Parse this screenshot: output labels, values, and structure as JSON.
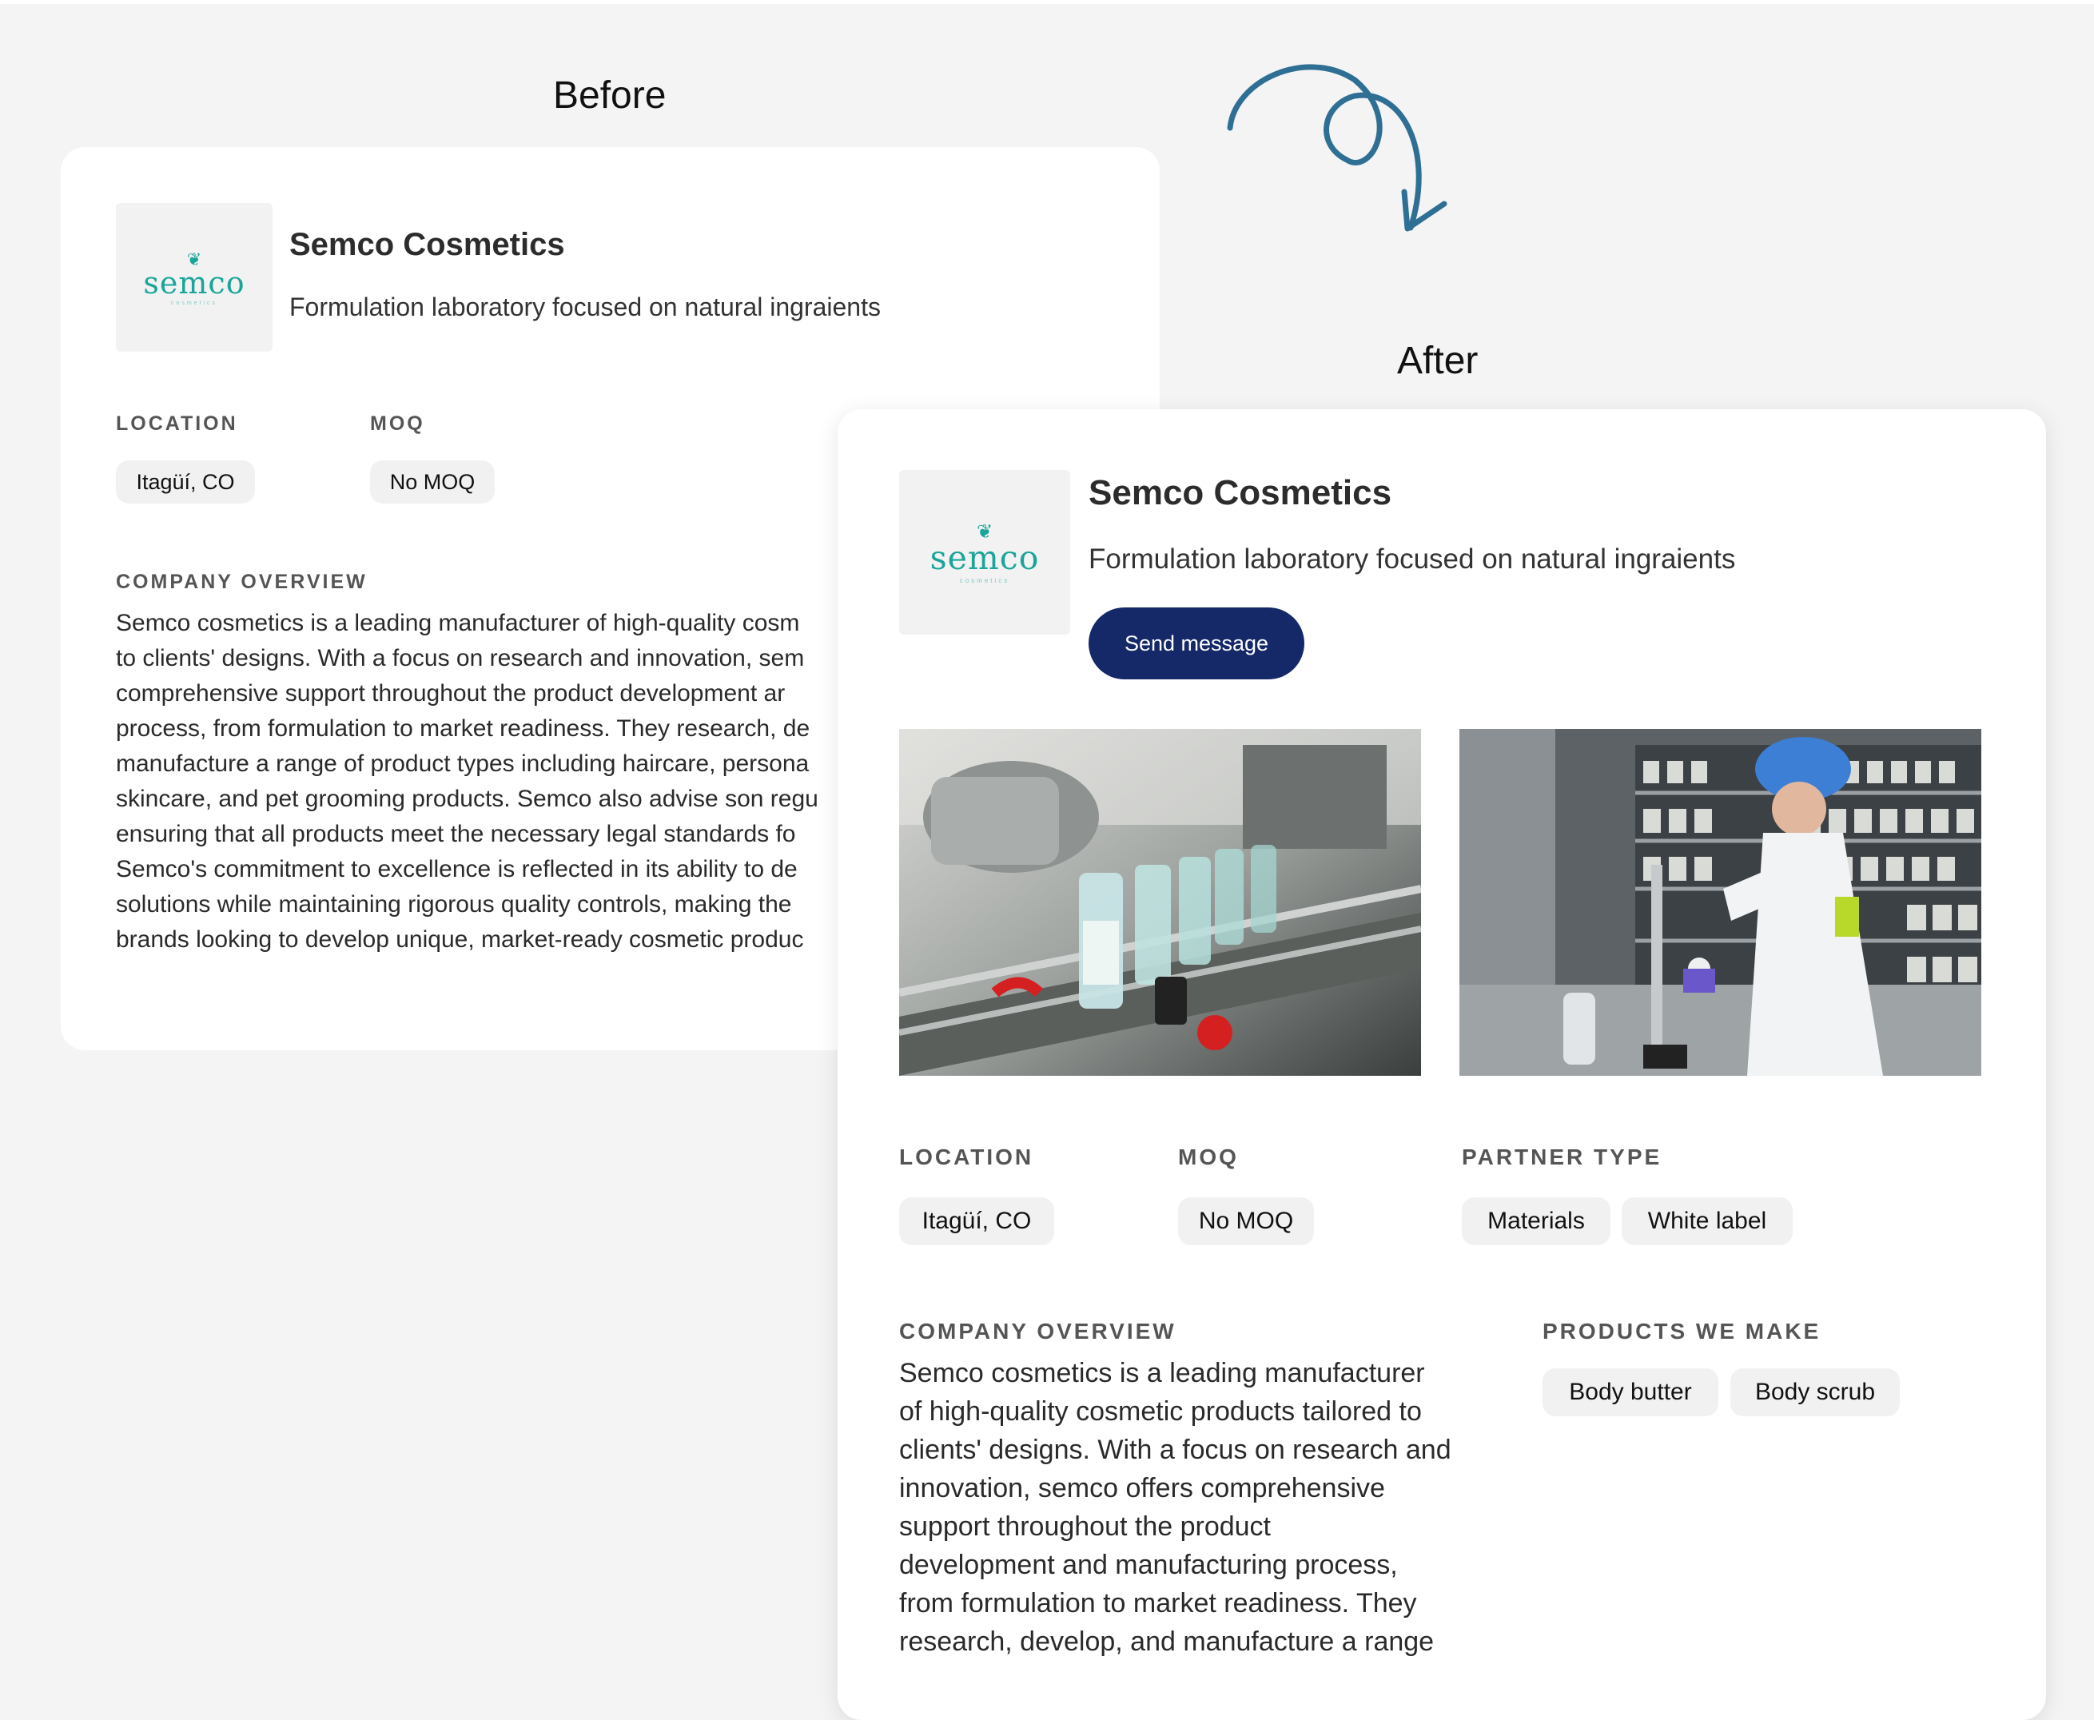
{
  "labels": {
    "before": "Before",
    "after": "After"
  },
  "company": {
    "logo_text": "semco",
    "logo_sub": "cosmetics",
    "name": "Semco Cosmetics",
    "tagline": "Formulation laboratory focused on natural ingraients"
  },
  "before": {
    "location_label": "LOCATION",
    "location_value": "Itagüí, CO",
    "moq_label": "MOQ",
    "moq_value": "No MOQ",
    "overview_label": "COMPANY OVERVIEW",
    "overview_lines": [
      "Semco cosmetics is a leading manufacturer of high-quality cosm",
      "to clients' designs. With a focus on research and innovation, sem",
      "comprehensive support throughout the product development ar",
      "process, from formulation to market readiness. They research, de",
      "manufacture a range of product types including haircare, persona",
      "skincare, and pet grooming products. Semco also advise son regu",
      "ensuring that all products meet the necessary legal standards fo",
      "Semco's commitment to excellence is reflected in its ability to de",
      "solutions while maintaining rigorous quality controls, making the",
      "brands looking to develop unique, market-ready cosmetic produc"
    ]
  },
  "after": {
    "send_message": "Send message",
    "location_label": "LOCATION",
    "location_value": "Itagüí, CO",
    "moq_label": "MOQ",
    "moq_value": "No MOQ",
    "partner_label": "PARTNER TYPE",
    "partner_types": [
      "Materials",
      "White label"
    ],
    "overview_label": "COMPANY OVERVIEW",
    "overview_lines": [
      "Semco cosmetics is a leading manufacturer",
      "of high-quality cosmetic products tailored to",
      "clients' designs. With a focus on research and",
      "innovation, semco offers comprehensive",
      "support throughout the product",
      "development and manufacturing process,",
      "from formulation to market readiness. They",
      "research, develop, and manufacture a range"
    ],
    "products_label": "PRODUCTS WE MAKE",
    "products": [
      "Body butter",
      "Body scrub"
    ]
  },
  "colors": {
    "accent_button": "#152867",
    "logo_teal": "#1aa59a",
    "arrow": "#2f6f94"
  }
}
